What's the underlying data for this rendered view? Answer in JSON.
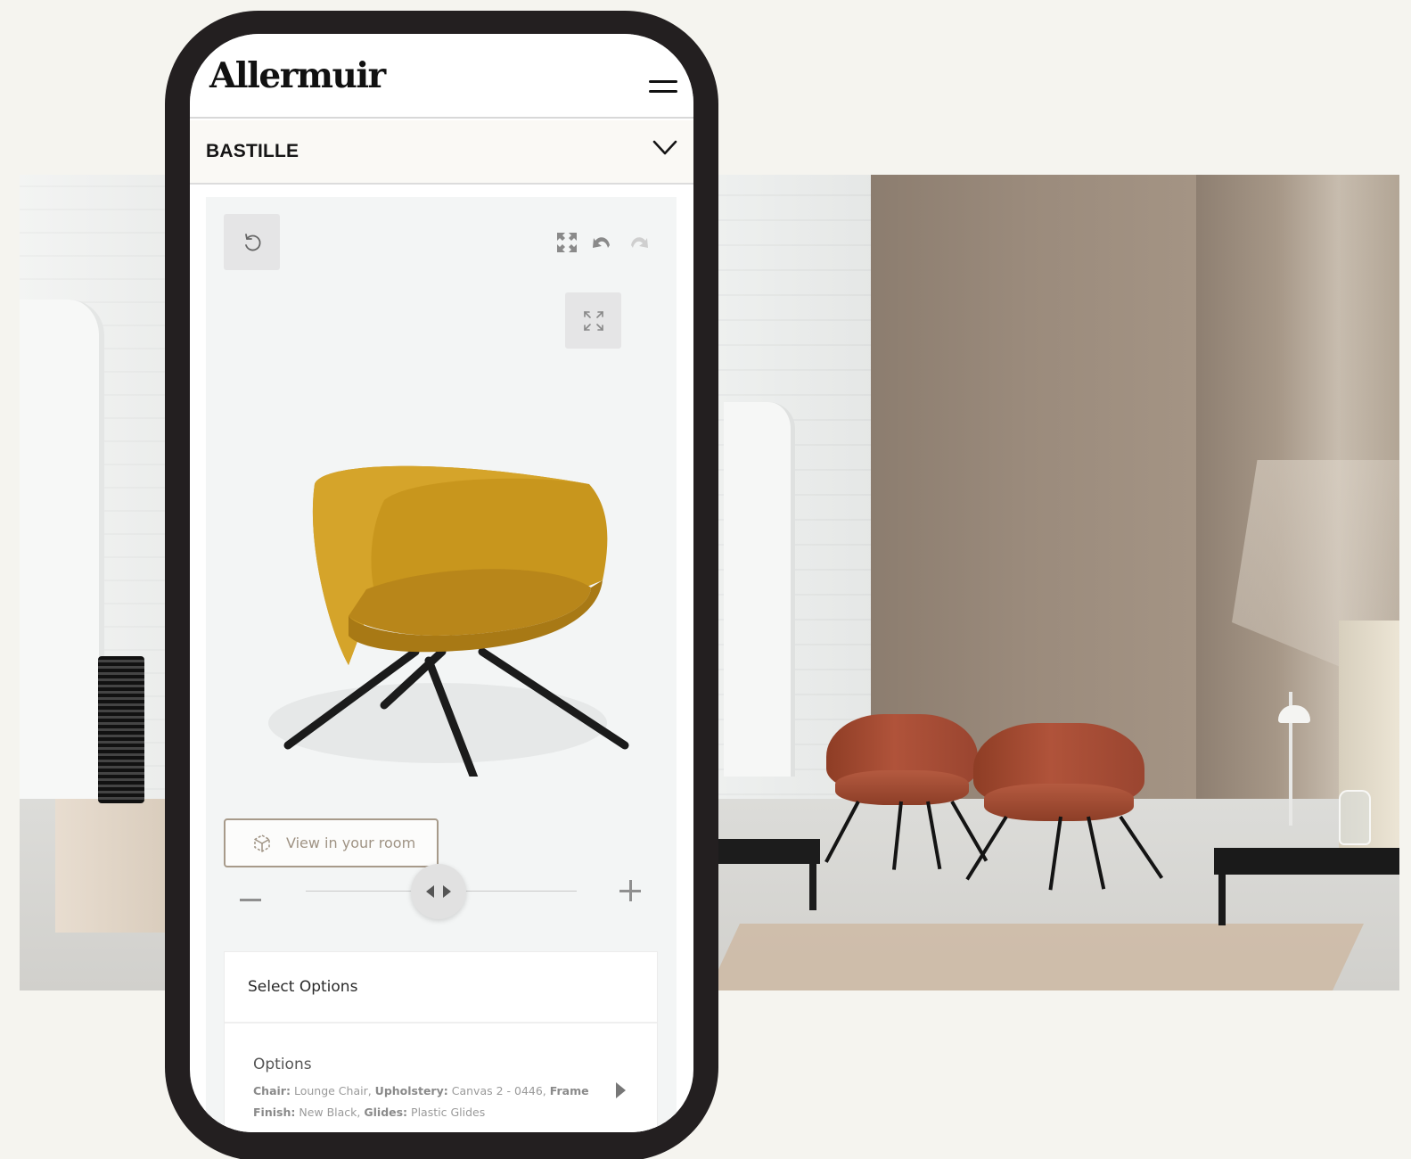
{
  "app": {
    "brand": "Allermuir",
    "product_name": "BASTILLE"
  },
  "viewer": {
    "ar_button_label": "View in your room",
    "zoom_level": 0.49
  },
  "options": {
    "title": "Select Options",
    "heading": "Options",
    "fields": [
      {
        "label": "Chair:",
        "value": "Lounge Chair,"
      },
      {
        "label": "Upholstery:",
        "value": "Canvas 2 - 0446,"
      },
      {
        "label": "Frame Finish:",
        "value": "New Black,"
      },
      {
        "label": "Glides:",
        "value": "Plastic Glides"
      }
    ]
  },
  "colors": {
    "phone_frame": "#231f20",
    "chair_mustard": "#c9961d",
    "chair_rust": "#a64c33",
    "ar_border": "#a79a8a",
    "page_bg": "#f5f4ef"
  },
  "icons": {
    "menu": "hamburger-icon",
    "dropdown": "chevron-down-icon",
    "reset": "reset-icon",
    "expand": "expand-icon",
    "undo": "undo-icon",
    "redo": "redo-icon",
    "fullscreen": "fullscreen-icon",
    "ar": "cube-ar-icon",
    "zoom_out": "minus-icon",
    "zoom_in": "plus-icon",
    "next": "caret-right-icon"
  }
}
